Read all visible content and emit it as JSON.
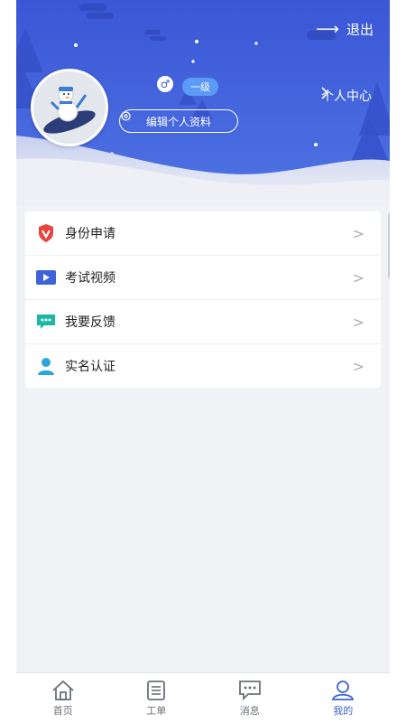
{
  "header": {
    "logout_label": "退出",
    "level_label": "一级",
    "edit_profile_label": "编辑个人资料",
    "personal_center_label": "个人中心"
  },
  "menu": {
    "items": [
      {
        "label": "身份申请",
        "icon": "shield-v-icon",
        "color": "#e8453f"
      },
      {
        "label": "考试视频",
        "icon": "video-play-icon",
        "color": "#3d63d8"
      },
      {
        "label": "我要反馈",
        "icon": "feedback-chat-icon",
        "color": "#1bb7a4"
      },
      {
        "label": "实名认证",
        "icon": "user-person-icon",
        "color": "#2aa6d9"
      }
    ],
    "chevron": ">"
  },
  "tabbar": {
    "tabs": [
      {
        "label": "首页",
        "icon": "home-icon",
        "active": false
      },
      {
        "label": "工单",
        "icon": "clipboard-icon",
        "active": false
      },
      {
        "label": "消息",
        "icon": "message-icon",
        "active": false
      },
      {
        "label": "我的",
        "icon": "profile-icon",
        "active": true
      }
    ]
  },
  "colors": {
    "header_blue": "#3f5fd9",
    "accent": "#3d63d8",
    "level_badge": "#5b9af5",
    "background": "#f1f2f5"
  }
}
